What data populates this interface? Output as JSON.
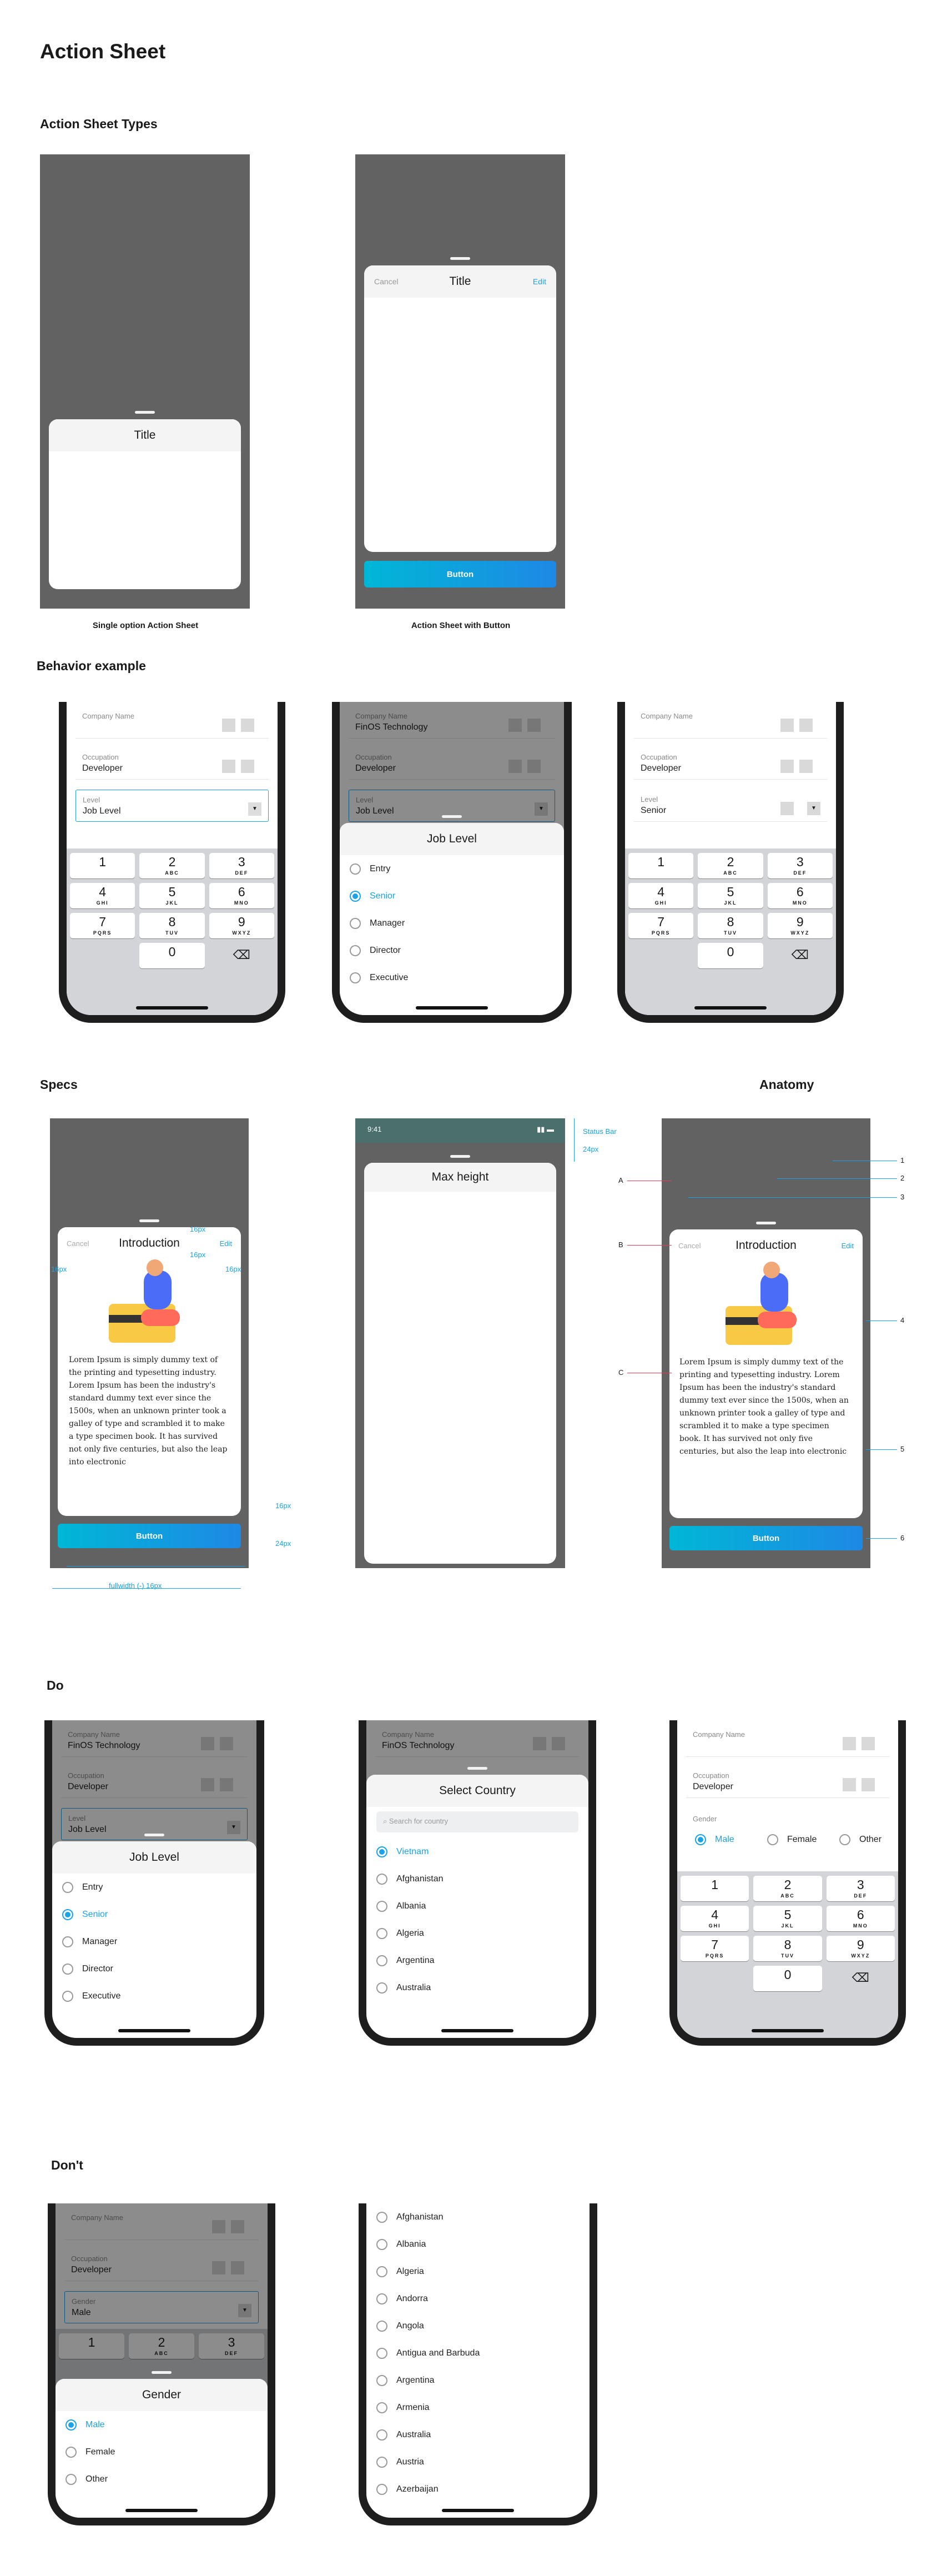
{
  "page": {
    "title": "Action Sheet"
  },
  "sections": {
    "types": "Action Sheet Types",
    "behavior": "Behavior example",
    "specs": "Specs",
    "anatomy": "Anatomy",
    "do": "Do",
    "dont": "Don't"
  },
  "types": {
    "single": {
      "caption": "Single option Action  Sheet",
      "title": "Title"
    },
    "with_button": {
      "caption": "Action Sheet with Button",
      "cancel": "Cancel",
      "title": "Title",
      "edit": "Edit",
      "button": "Button"
    }
  },
  "form": {
    "company_label": "Company Name",
    "company_value": "FinOS Technology",
    "occupation_label": "Occupation",
    "occupation_value": "Developer",
    "level_label": "Level",
    "level_placeholder": "Job Level",
    "level_value": "Senior",
    "gender_label": "Gender",
    "gender_value": "Male"
  },
  "keypad": {
    "keys": [
      {
        "n": "1",
        "l": ""
      },
      {
        "n": "2",
        "l": "ABC"
      },
      {
        "n": "3",
        "l": "DEF"
      },
      {
        "n": "4",
        "l": "GHI"
      },
      {
        "n": "5",
        "l": "JKL"
      },
      {
        "n": "6",
        "l": "MNO"
      },
      {
        "n": "7",
        "l": "PQRS"
      },
      {
        "n": "8",
        "l": "TUV"
      },
      {
        "n": "9",
        "l": "WXYZ"
      }
    ],
    "zero": "0"
  },
  "job_sheet": {
    "title": "Job Level",
    "options": [
      "Entry",
      "Senior",
      "Manager",
      "Director",
      "Executive"
    ],
    "selected": "Senior"
  },
  "gender": {
    "options": [
      "Male",
      "Female",
      "Other"
    ],
    "selected": "Male",
    "sheet_title": "Gender"
  },
  "specs": {
    "cancel": "Cancel",
    "title": "Introduction",
    "edit": "Edit",
    "body": "Lorem Ipsum is simply dummy text of the printing and typesetting industry. Lorem Ipsum has been the industry's standard dummy text ever since the 1500s, when an unknown printer took a galley of type and scrambled it to make a type specimen book. It has survived not only five centuries, but also the leap into electronic",
    "button": "Button",
    "dims": {
      "d16": "16px",
      "d24": "24px",
      "fullwidth": "fullwidth (-) 16px"
    },
    "max_height": "Max height",
    "time": "9:41",
    "status_bar": "Status Bar"
  },
  "anatomy": {
    "letters": [
      "A",
      "B",
      "C"
    ],
    "numbers": [
      "1",
      "2",
      "3",
      "4",
      "5",
      "6"
    ]
  },
  "country": {
    "title": "Select Country",
    "search_placeholder": "Search for country",
    "do_list": [
      "Vietnam",
      "Afghanistan",
      "Albania",
      "Algeria",
      "Argentina",
      "Australia"
    ],
    "selected": "Vietnam",
    "dont_list": [
      "Afghanistan",
      "Albania",
      "Algeria",
      "Andorra",
      "Angola",
      "Antigua and Barbuda",
      "Argentina",
      "Armenia",
      "Australia",
      "Austria",
      "Azerbaijan"
    ]
  },
  "colors": {
    "accent": "#1aa3e6",
    "overlay": "#626262",
    "button_from": "#00b7d6",
    "button_to": "#1e88e5"
  }
}
